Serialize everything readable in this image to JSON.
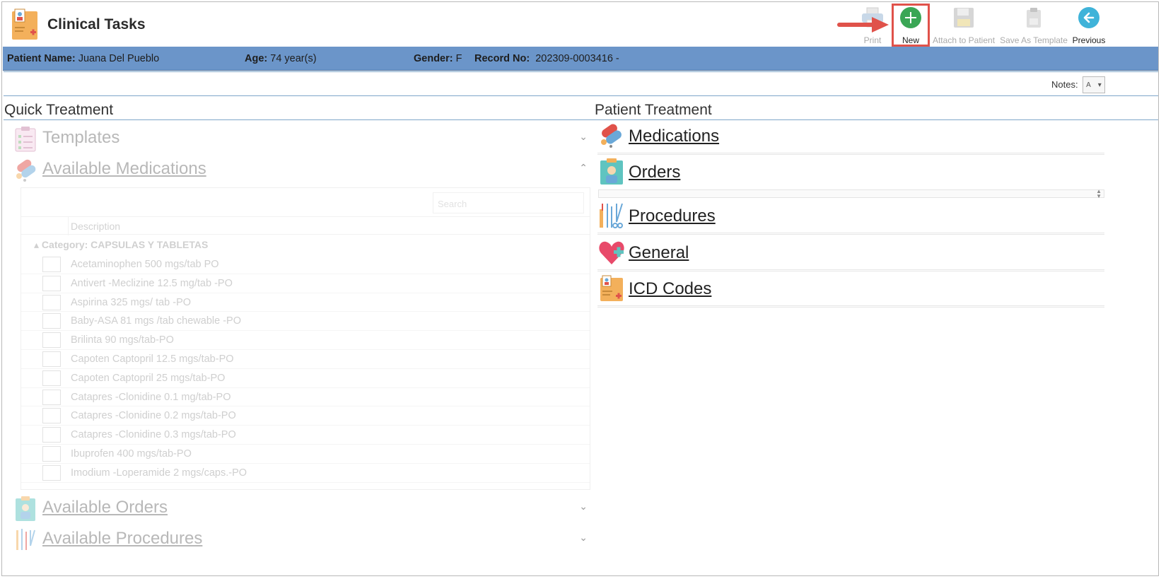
{
  "app": {
    "title": "Clinical Tasks",
    "icon": "clipboard-icon"
  },
  "toolbar": {
    "print": {
      "label": "Print",
      "icon": "printer-icon",
      "enabled": false
    },
    "new": {
      "label": "New",
      "icon": "plus-circle-icon",
      "enabled": true,
      "highlighted": true
    },
    "attach": {
      "label": "Attach to Patient",
      "icon": "floppy-disk-icon",
      "enabled": false
    },
    "save_template": {
      "label": "Save As Template",
      "icon": "clipboard-save-icon",
      "enabled": false
    },
    "previous": {
      "label": "Previous",
      "icon": "arrow-left-circle-icon",
      "enabled": true
    }
  },
  "patient": {
    "name_label": "Patient Name:",
    "name": "Juana Del Pueblo",
    "age_label": "Age:",
    "age": "74 year(s)",
    "gender_label": "Gender:",
    "gender": "F",
    "record_label": "Record No:",
    "record": "202309-0003416 -"
  },
  "notes": {
    "label": "Notes:",
    "icon": "text-format-icon"
  },
  "quick_treatment": {
    "title": "Quick Treatment",
    "sections": [
      {
        "label": "Templates",
        "icon": "checklist-icon",
        "expanded": false
      },
      {
        "label": "Available Medications",
        "icon": "pills-icon",
        "expanded": true
      },
      {
        "label": "Available Orders",
        "icon": "doctor-clipboard-icon",
        "expanded": false
      },
      {
        "label": "Available Procedures",
        "icon": "surgical-tools-icon",
        "expanded": false
      }
    ],
    "medications_grid": {
      "search_placeholder": "Search",
      "column": "Description",
      "category": "Category: CAPSULAS Y TABLETAS",
      "rows": [
        "Acetaminophen 500 mgs/tab PO",
        "Antivert -Meclizine 12.5 mg/tab -PO",
        "Aspirina 325 mgs/ tab -PO",
        "Baby-ASA 81 mgs /tab chewable -PO",
        "Brilinta 90 mgs/tab-PO",
        "Capoten Captopril 12.5 mgs/tab-PO",
        "Capoten Captopril 25 mgs/tab-PO",
        "Catapres -Clonidine 0.1 mg/tab-PO",
        "Catapres -Clonidine 0.2 mgs/tab-PO",
        "Catapres -Clonidine 0.3 mgs/tab-PO",
        "Ibuprofen 400 mgs/tab-PO",
        "Imodium -Loperamide 2 mgs/caps.-PO"
      ]
    }
  },
  "patient_treatment": {
    "title": "Patient Treatment",
    "items": [
      {
        "label": "Medications",
        "icon": "pills-icon"
      },
      {
        "label": "Orders",
        "icon": "doctor-clipboard-icon"
      },
      {
        "label": "Procedures",
        "icon": "surgical-tools-icon"
      },
      {
        "label": "General",
        "icon": "heart-plus-icon"
      },
      {
        "label": "ICD Codes",
        "icon": "clipboard-icon"
      }
    ]
  },
  "colors": {
    "patient_bar": "#6b95c9",
    "new_button": "#3aa655",
    "previous_button": "#3fb3d9",
    "highlight": "#e0524a"
  }
}
